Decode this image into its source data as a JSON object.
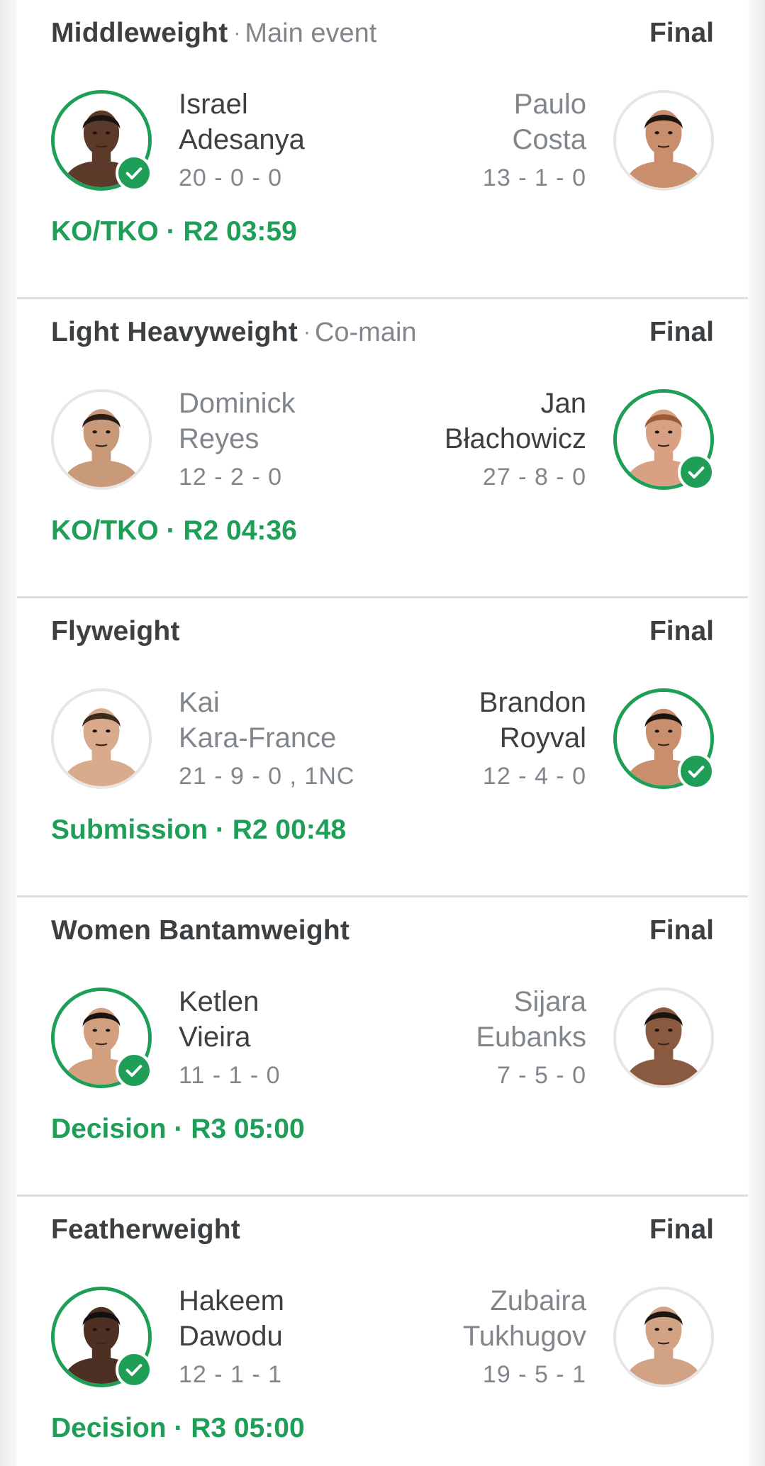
{
  "fights": [
    {
      "weight_class": "Middleweight",
      "event_label": "Main event",
      "status": "Final",
      "result": "KO/TKO · R2 03:59",
      "left": {
        "first": "Israel",
        "last": "Adesanya",
        "record": "20 - 0 - 0",
        "winner": true,
        "skin": "#5b3a29",
        "hair": "#1c1410"
      },
      "right": {
        "first": "Paulo",
        "last": "Costa",
        "record": "13 - 1 - 0",
        "winner": false,
        "skin": "#c98f6d",
        "hair": "#1e1612"
      }
    },
    {
      "weight_class": "Light Heavyweight",
      "event_label": "Co-main",
      "status": "Final",
      "result": "KO/TKO · R2 04:36",
      "left": {
        "first": "Dominick",
        "last": "Reyes",
        "record": "12 - 2 - 0",
        "winner": false,
        "skin": "#c99a7a",
        "hair": "#2a1d16"
      },
      "right": {
        "first": "Jan",
        "last": "Błachowicz",
        "record": "27 - 8 - 0",
        "winner": true,
        "skin": "#d8a184",
        "hair": "#9b5a33"
      }
    },
    {
      "weight_class": "Flyweight",
      "event_label": "",
      "status": "Final",
      "result": "Submission · R2 00:48",
      "left": {
        "first": "Kai",
        "last": "Kara-France",
        "record": "21 - 9 - 0 , 1NC",
        "winner": false,
        "skin": "#d9ab8c",
        "hair": "#3a2a20"
      },
      "right": {
        "first": "Brandon",
        "last": "Royval",
        "record": "12 - 4 - 0",
        "winner": true,
        "skin": "#c98f6d",
        "hair": "#1a1410"
      }
    },
    {
      "weight_class": "Women Bantamweight",
      "event_label": "",
      "status": "Final",
      "result": "Decision · R3 05:00",
      "left": {
        "first": "Ketlen",
        "last": "Vieira",
        "record": "11 - 1 - 0",
        "winner": true,
        "skin": "#d3a07f",
        "hair": "#1a1410"
      },
      "right": {
        "first": "Sijara",
        "last": "Eubanks",
        "record": "7 - 5 - 0",
        "winner": false,
        "skin": "#8a5a40",
        "hair": "#1a1410"
      }
    },
    {
      "weight_class": "Featherweight",
      "event_label": "",
      "status": "Final",
      "result": "Decision · R3 05:00",
      "left": {
        "first": "Hakeem",
        "last": "Dawodu",
        "record": "12 - 1 - 1",
        "winner": true,
        "skin": "#4d3023",
        "hair": "#151010"
      },
      "right": {
        "first": "Zubaira",
        "last": "Tukhugov",
        "record": "19 - 5 - 1",
        "winner": false,
        "skin": "#d2a285",
        "hair": "#1e1612"
      }
    }
  ]
}
